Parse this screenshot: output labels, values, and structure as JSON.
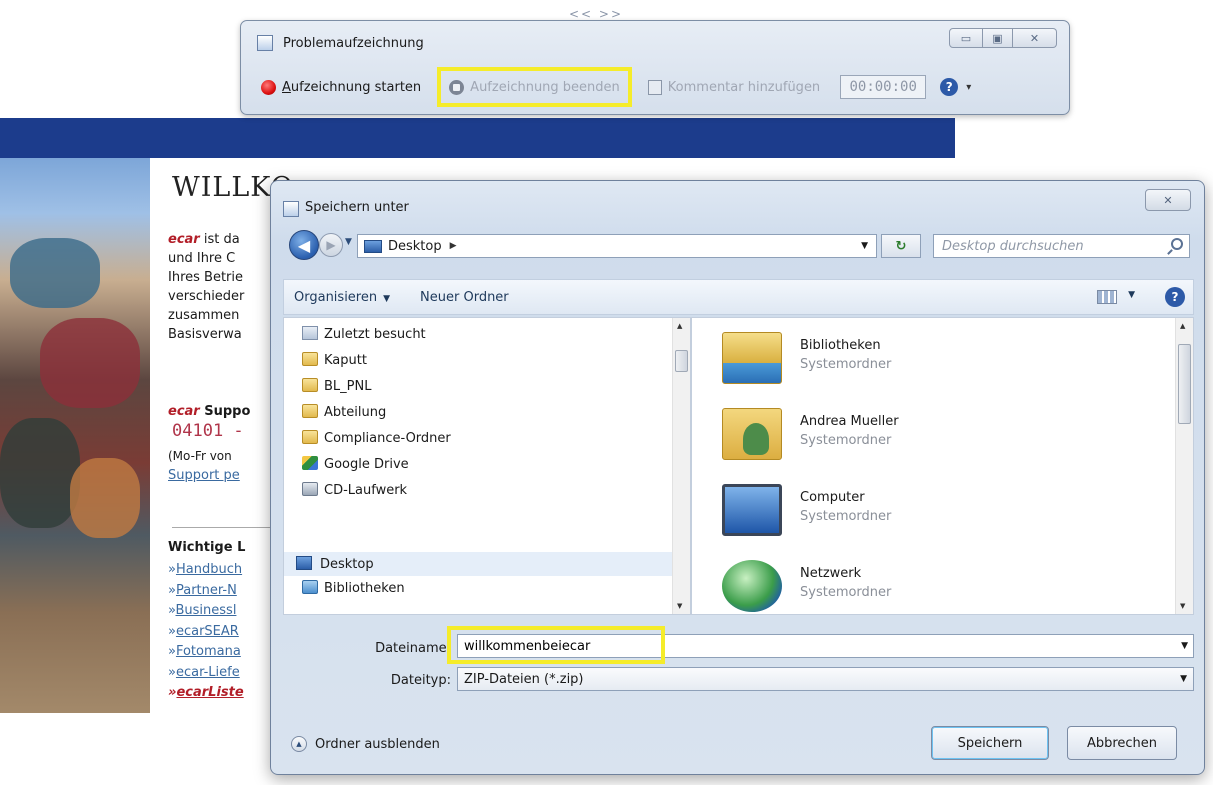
{
  "background_page": {
    "heading_prefix": "WILLKO",
    "heading_brand": "ecar",
    "intro_brand": "ecar",
    "intro_lines": [
      " ist da",
      "und Ihre C",
      "Ihres Betrie",
      "verschieder",
      "zusammen",
      "Basisverwa"
    ],
    "support_brand": "ecar",
    "support_label": " Suppo",
    "phone": "04101 - ",
    "hours": "(Mo-Fr von ",
    "support_link": "Support pe",
    "links_title": "Wichtige L",
    "links": [
      "Handbuch",
      "Partner-N",
      "Businessl",
      "ecarSEAR",
      "Fotomana",
      "ecar-Liefe",
      "ecarListe"
    ],
    "link_prefix": "»"
  },
  "psr": {
    "title": "Problemaufzeichnung",
    "bg_numbers": "<< >>",
    "start_label_u": "A",
    "start_label_rest": "ufzeichnung starten",
    "stop_label": "Aufzeichnung beenden",
    "comment_label": "Kommentar hinzufügen",
    "timer": "00:00:00",
    "help": "?",
    "dropdown": "▾",
    "btn_min": "▭",
    "btn_max": "▣",
    "btn_close": "✕"
  },
  "dialog": {
    "title": "Speichern unter",
    "close": "✕",
    "back": "◀",
    "forward": "▶",
    "path": "Desktop",
    "path_arrow": "▶",
    "refresh": "↻",
    "search_placeholder": "Desktop durchsuchen",
    "organize": "Organisieren",
    "new_folder": "Neuer Ordner",
    "help": "?",
    "nav_items": [
      "Zuletzt besucht",
      "Kaputt",
      "BL_PNL",
      "Abteilung",
      "Compliance-Ordner",
      "Google Drive",
      "CD-Laufwerk",
      "Desktop",
      "Bibliotheken"
    ],
    "content_items": [
      {
        "name": "Bibliotheken",
        "type": "Systemordner"
      },
      {
        "name": "Andrea Mueller",
        "type": "Systemordner"
      },
      {
        "name": "Computer",
        "type": "Systemordner"
      },
      {
        "name": "Netzwerk",
        "type": "Systemordner"
      }
    ],
    "filename_label": "Dateiname:",
    "filename_value": "willkommenbeiecar",
    "filetype_label": "Dateityp:",
    "filetype_value": "ZIP-Dateien (*.zip)",
    "hide_folders": "Ordner ausblenden",
    "save": "Speichern",
    "cancel": "Abbrechen"
  },
  "colors": {
    "highlight": "#f5ec2a",
    "nav_bar": "#1c3c8c",
    "brand_red": "#d0232b"
  }
}
